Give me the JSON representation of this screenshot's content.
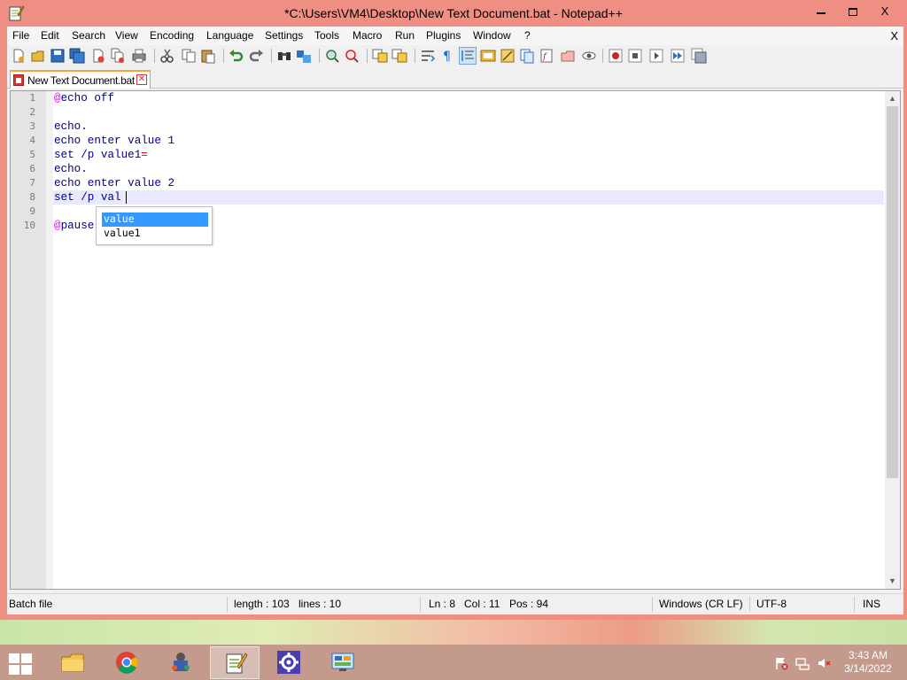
{
  "window": {
    "title": "*C:\\Users\\VM4\\Desktop\\New Text Document.bat - Notepad++",
    "controls": {
      "minimize": "—",
      "maximize": "□",
      "close": "X"
    }
  },
  "menubar": {
    "items": [
      "File",
      "Edit",
      "Search",
      "View",
      "Encoding",
      "Language",
      "Settings",
      "Tools",
      "Macro",
      "Run",
      "Plugins",
      "Window",
      "?"
    ],
    "close_doc": "X"
  },
  "toolbar": {
    "icons": [
      "new-file-icon",
      "open-file-icon",
      "save-icon",
      "save-all-icon",
      "close-icon",
      "close-all-icon",
      "print-icon",
      "cut-icon",
      "copy-icon",
      "paste-icon",
      "undo-icon",
      "redo-icon",
      "find-icon",
      "replace-icon",
      "zoom-in-icon",
      "zoom-out-icon",
      "sync-vertical-icon",
      "sync-horizontal-icon",
      "word-wrap-icon",
      "show-all-chars-icon",
      "indent-guide-icon",
      "user-defined-language-icon",
      "doc-map-icon",
      "function-list-icon",
      "folder-as-workspace-icon",
      "monitoring-icon",
      "record-macro-icon",
      "stop-record-icon",
      "play-macro-icon",
      "run-macro-multiple-icon",
      "save-macro-icon"
    ]
  },
  "tabs": [
    {
      "label": "New Text Document.bat",
      "close": "✕"
    }
  ],
  "editor": {
    "line_numbers": [
      "1",
      "2",
      "3",
      "4",
      "5",
      "6",
      "7",
      "8",
      "9",
      "10"
    ],
    "lines": [
      [
        {
          "t": "@",
          "c": "at"
        },
        {
          "t": "echo",
          "c": "kw"
        },
        {
          "t": " off",
          "c": "kw"
        }
      ],
      [],
      [
        {
          "t": "echo.",
          "c": "kw"
        }
      ],
      [
        {
          "t": "echo",
          "c": "kw"
        },
        {
          "t": " enter value 1",
          "c": "kw"
        }
      ],
      [
        {
          "t": "set",
          "c": "kw"
        },
        {
          "t": " /p value1",
          "c": "kw"
        },
        {
          "t": "=",
          "c": "op"
        }
      ],
      [
        {
          "t": "echo.",
          "c": "kw"
        }
      ],
      [
        {
          "t": "echo",
          "c": "kw"
        },
        {
          "t": " enter value 2",
          "c": "kw"
        }
      ],
      [
        {
          "t": "set",
          "c": "kw"
        },
        {
          "t": " /p val",
          "c": "kw"
        }
      ],
      [],
      [
        {
          "t": "@",
          "c": "at"
        },
        {
          "t": "pause",
          "c": "kw"
        }
      ]
    ],
    "current_line": 8
  },
  "autocomplete": {
    "items": [
      "value",
      "value1"
    ],
    "selected": 0
  },
  "statusbar": {
    "file_type": "Batch file",
    "length": "length : 103",
    "lines": "lines : 10",
    "ln": "Ln : 8",
    "col": "Col : 11",
    "pos": "Pos : 94",
    "eol": "Windows (CR LF)",
    "encoding": "UTF-8",
    "mode": "INS"
  },
  "taskbar": {
    "apps": [
      "file-explorer-icon",
      "chrome-icon",
      "network-tool-icon",
      "notepad-plus-plus-icon",
      "settings-gear-icon",
      "control-panel-icon"
    ],
    "active_app": "notepad-plus-plus-icon",
    "tray": [
      "action-center-flag-icon",
      "network-icon",
      "volume-muted-icon"
    ],
    "clock_time": "3:43 AM",
    "clock_date": "3/14/2022"
  },
  "colors": {
    "window_frame": "#ef8f84",
    "current_line": "#e8e8ff",
    "keyword": "#00008b",
    "at_sign": "#ff00ff",
    "operator": "#ff0000",
    "autocomplete_selection": "#3399ff",
    "taskbar": "#c49a8c"
  }
}
